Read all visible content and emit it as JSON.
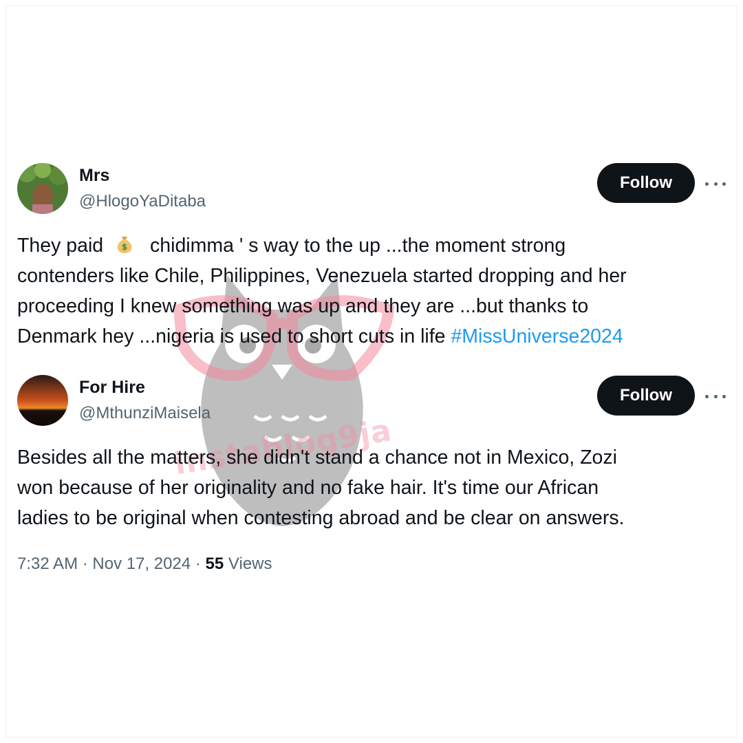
{
  "tweets": [
    {
      "display_name": "Mrs",
      "handle": "@HlogoYaDitaba",
      "follow_label": "Follow",
      "body": {
        "line1_before": "They paid",
        "line1_icon": "money-bag-icon",
        "line1_after": "chidimma ' s way to the up ...the moment strong",
        "line2": "contenders like Chile, Philippines,  Venezuela started dropping and her",
        "line3": "proceeding I knew something was up and they are ...but  thanks to",
        "line4_text": "Denmark hey ...nigeria is  used to short cuts in life ",
        "line4_hashtag": "#MissUniverse2024"
      }
    },
    {
      "display_name": "For Hire",
      "handle": "@MthunziMaisela",
      "follow_label": "Follow",
      "body": {
        "line1": "Besides all the matters, she didn't stand a chance not in Mexico, Zozi",
        "line2": "won because of her originality and no fake hair. It's time our African",
        "line3": "ladies to be original when contesting abroad and be clear on answers."
      }
    }
  ],
  "meta": {
    "time": "7:32 AM",
    "separator": "·",
    "date": "Nov 17, 2024",
    "views_count": "55",
    "views_label": "Views"
  },
  "watermark": {
    "text": "instablog9ja"
  },
  "colors": {
    "text": "#0f1419",
    "secondary": "#536471",
    "hashtag": "#1d9bf0",
    "button": "#0f1419"
  }
}
